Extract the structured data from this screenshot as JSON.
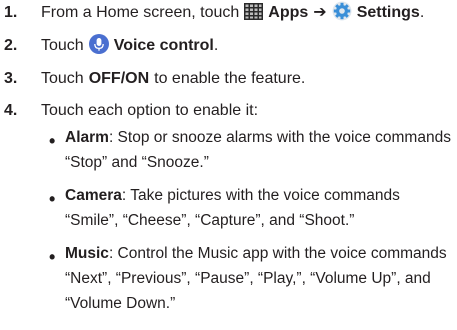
{
  "steps": [
    {
      "number": "1.",
      "prefix": "From a Home screen, touch",
      "apps_label": "Apps",
      "arrow": "➔",
      "settings_label": "Settings",
      "suffix": "."
    },
    {
      "number": "2.",
      "prefix": "Touch",
      "voice_label": "Voice control",
      "suffix": "."
    },
    {
      "number": "3.",
      "prefix": "Touch",
      "bold": "OFF/ON",
      "suffix": "to enable the feature."
    },
    {
      "number": "4.",
      "text": "Touch each option to enable it:"
    }
  ],
  "bullets": [
    {
      "title": "Alarm",
      "lines": [
        ": Stop or snooze alarms with the voice commands",
        "“Stop” and “Snooze.”"
      ]
    },
    {
      "title": "Camera",
      "lines": [
        ": Take pictures with the voice commands",
        "“Smile”, “Cheese”, “Capture”, and “Shoot.”"
      ]
    },
    {
      "title": "Music",
      "lines": [
        ": Control the Music app with the voice commands",
        "“Next”, “Previous”, “Pause”, “Play,”, “Volume Up”, and",
        "“Volume Down.”"
      ]
    }
  ],
  "bullet_char": "•",
  "icons": {
    "apps": "apps-grid-icon",
    "settings": "settings-gear-icon",
    "voice": "voice-control-microphone-icon"
  },
  "colors": {
    "text": "#231f20",
    "voice_icon": "#4a6fd0",
    "settings_icon": "#3a8fd8"
  }
}
